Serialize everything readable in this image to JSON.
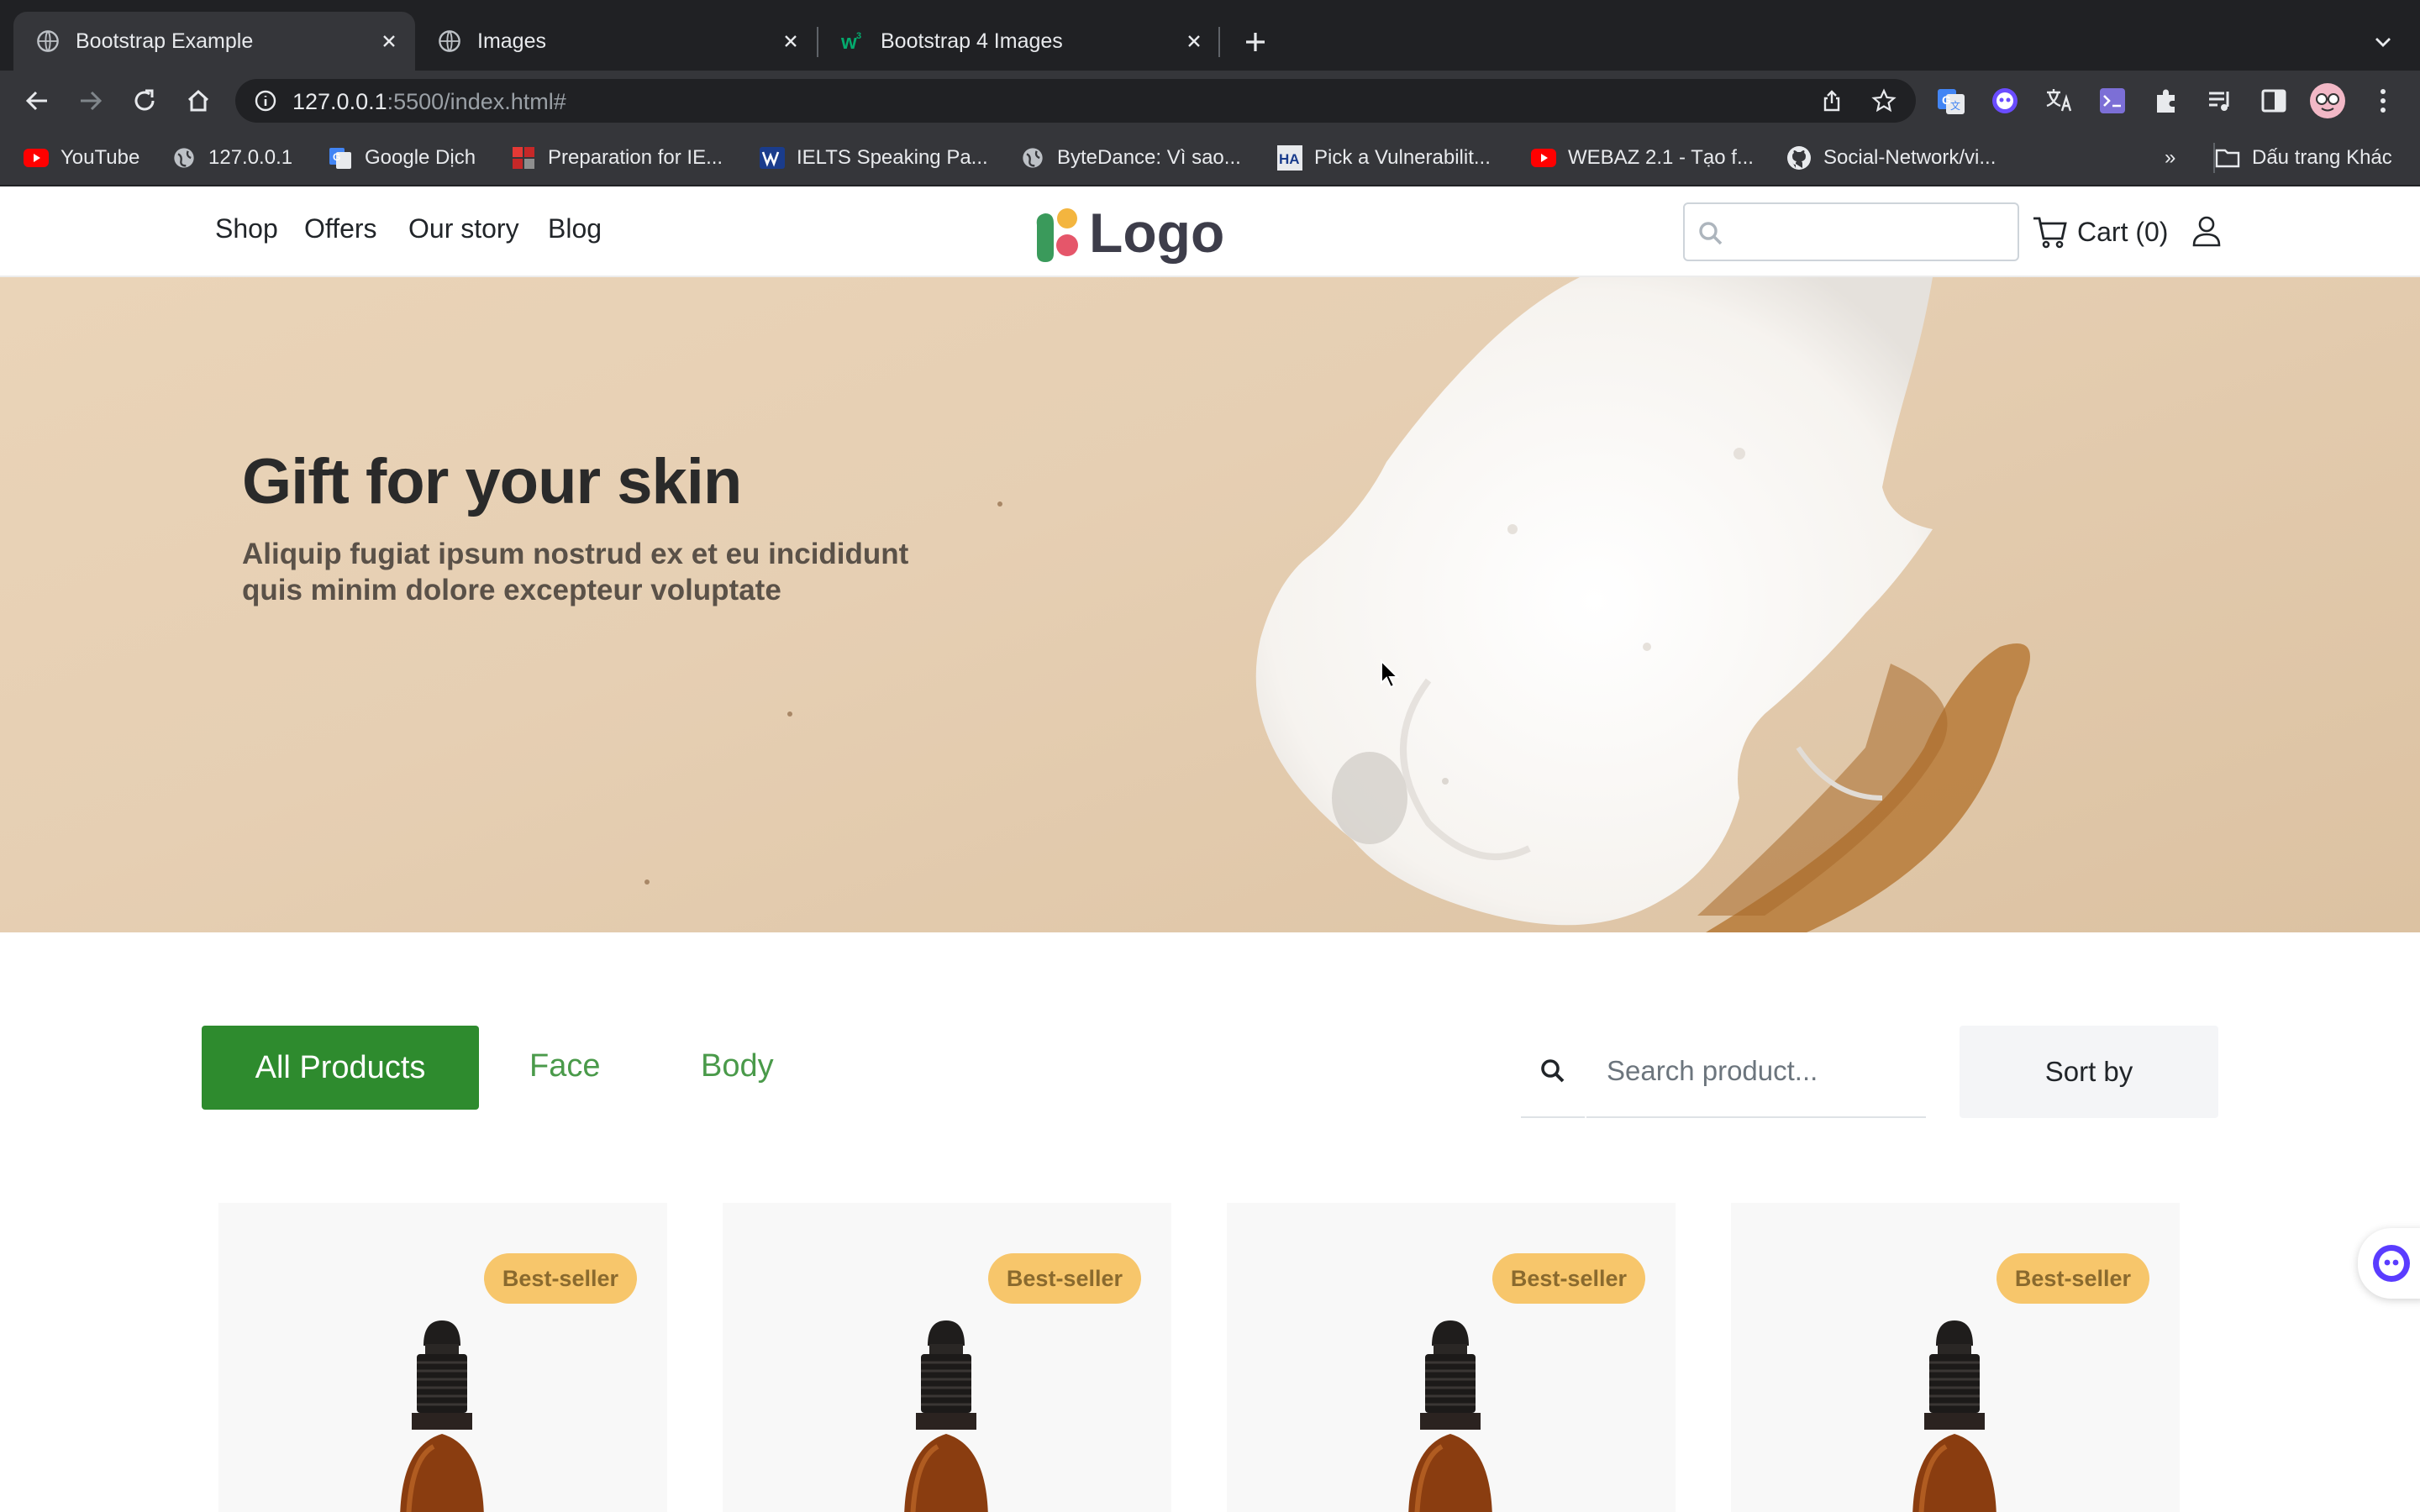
{
  "browser": {
    "tabs": [
      {
        "title": "Bootstrap Example",
        "active": true
      },
      {
        "title": "Images",
        "active": false
      },
      {
        "title": "Bootstrap 4 Images",
        "active": false
      }
    ],
    "url_host": "127.0.0.1",
    "url_path": ":5500/index.html#",
    "bookmarks": [
      {
        "label": "YouTube",
        "icon": "youtube-icon"
      },
      {
        "label": "127.0.0.1",
        "icon": "globe-icon"
      },
      {
        "label": "Google Dịch",
        "icon": "google-translate-icon"
      },
      {
        "label": "Preparation for IE...",
        "icon": "bookmark-red-icon"
      },
      {
        "label": "IELTS Speaking Pa...",
        "icon": "ielts-icon"
      },
      {
        "label": "ByteDance: Vì sao...",
        "icon": "globe-icon"
      },
      {
        "label": "Pick a Vulnerabilit...",
        "icon": "ha-icon"
      },
      {
        "label": "WEBAZ 2.1 - Tạo f...",
        "icon": "youtube-icon"
      },
      {
        "label": "Social-Network/vi...",
        "icon": "github-icon"
      }
    ],
    "bookmarks_overflow": "»",
    "other_bookmarks": "Dấu trang Khác"
  },
  "nav": {
    "links": [
      "Shop",
      "Offers",
      "Our story",
      "Blog"
    ],
    "logo_text": "Logo",
    "cart_label": "Cart (0)"
  },
  "hero": {
    "title": "Gift for your skin",
    "subtitle": "Aliquip fugiat ipsum nostrud ex et eu incididunt quis minim dolore excepteur voluptate"
  },
  "filters": {
    "all_label": "All Products",
    "categories": [
      "Face",
      "Body"
    ],
    "search_placeholder": "Search product...",
    "sort_label": "Sort by"
  },
  "products": [
    {
      "badge": "Best-seller"
    },
    {
      "badge": "Best-seller"
    },
    {
      "badge": "Best-seller"
    },
    {
      "badge": "Best-seller"
    }
  ],
  "colors": {
    "accent_green": "#2e8b2e",
    "badge_bg": "#f7c66b",
    "hero_bg": "#e6cfb3"
  }
}
